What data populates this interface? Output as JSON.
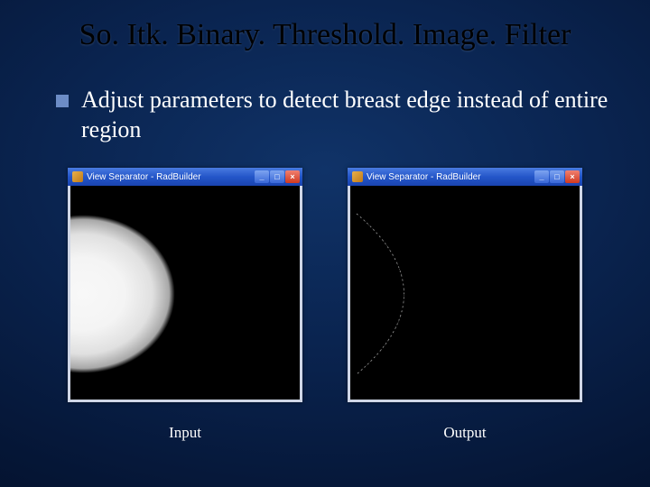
{
  "title": "So. Itk. Binary. Threshold. Image. Filter",
  "bullet": "Adjust parameters to detect breast edge instead of entire region",
  "windows": {
    "input": {
      "title": "View Separator - RadBuilder",
      "caption": "Input"
    },
    "output": {
      "title": "View Separator - RadBuilder",
      "caption": "Output"
    }
  }
}
